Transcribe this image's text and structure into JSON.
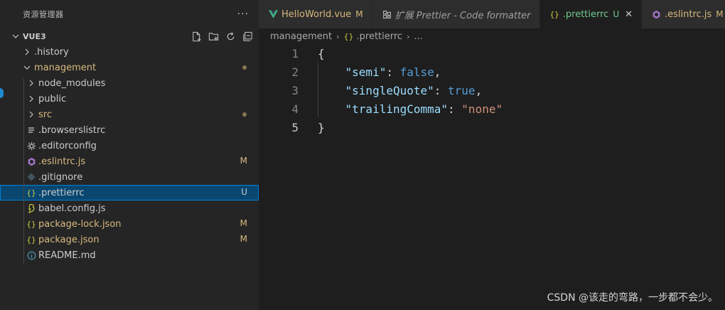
{
  "explorer": {
    "title": "资源管理器",
    "more": "···",
    "section": "VUE3",
    "actions": [
      "new-file-icon",
      "new-folder-icon",
      "refresh-icon",
      "collapse-all-icon"
    ],
    "items": [
      {
        "label": ".history",
        "type": "folder",
        "expanded": false,
        "indent": 1,
        "color": "#cccccc",
        "status": "",
        "dot": false
      },
      {
        "label": "management",
        "type": "folder",
        "expanded": true,
        "indent": 1,
        "color": "#d7ba7d",
        "status": "",
        "dot": true
      },
      {
        "label": "node_modules",
        "type": "folder",
        "expanded": false,
        "indent": 2,
        "color": "#cccccc",
        "status": "",
        "dot": false
      },
      {
        "label": "public",
        "type": "folder",
        "expanded": false,
        "indent": 2,
        "color": "#cccccc",
        "status": "",
        "dot": false
      },
      {
        "label": "src",
        "type": "folder",
        "expanded": false,
        "indent": 2,
        "color": "#d7ba7d",
        "status": "",
        "dot": true
      },
      {
        "label": ".browserslistrc",
        "type": "file",
        "icon": "lines",
        "iconColor": "#cccccc",
        "indent": 2,
        "color": "#cccccc",
        "status": "",
        "dot": false
      },
      {
        "label": ".editorconfig",
        "type": "file",
        "icon": "gear",
        "iconColor": "#a0a0a0",
        "indent": 2,
        "color": "#cccccc",
        "status": "",
        "dot": false
      },
      {
        "label": ".eslintrc.js",
        "type": "file",
        "icon": "eslint",
        "iconColor": "#a074c4",
        "indent": 2,
        "color": "#d7ba7d",
        "status": "M",
        "dot": false
      },
      {
        "label": ".gitignore",
        "type": "file",
        "icon": "git",
        "iconColor": "#41535b",
        "indent": 2,
        "color": "#cccccc",
        "status": "",
        "dot": false
      },
      {
        "label": ".prettierrc",
        "type": "file",
        "icon": "braces",
        "iconColor": "#cbcb41",
        "indent": 2,
        "color": "#cccccc",
        "status": "U",
        "dot": false,
        "selected": true
      },
      {
        "label": "babel.config.js",
        "type": "file",
        "icon": "babel",
        "iconColor": "#cbcb41",
        "indent": 2,
        "color": "#cccccc",
        "status": "",
        "dot": false
      },
      {
        "label": "package-lock.json",
        "type": "file",
        "icon": "braces",
        "iconColor": "#cbcb41",
        "indent": 2,
        "color": "#d7ba7d",
        "status": "M",
        "dot": false
      },
      {
        "label": "package.json",
        "type": "file",
        "icon": "braces",
        "iconColor": "#cbcb41",
        "indent": 2,
        "color": "#d7ba7d",
        "status": "M",
        "dot": false
      },
      {
        "label": "README.md",
        "type": "file",
        "icon": "info",
        "iconColor": "#519aba",
        "indent": 2,
        "color": "#cccccc",
        "status": "",
        "dot": false
      }
    ]
  },
  "tabs": [
    {
      "label": "HelloWorld.vue",
      "icon": "vue-icon",
      "iconColor": "#41b883",
      "color": "#d7ba7d",
      "status": "M",
      "italic": false,
      "active": false
    },
    {
      "label": "扩展 Prettier - Code formatter",
      "icon": "extension-icon",
      "iconColor": "#cccccc",
      "color": "#a0a0a0",
      "status": "",
      "italic": true,
      "active": false
    },
    {
      "label": ".prettierrc",
      "icon": "braces-icon",
      "iconColor": "#cbcb41",
      "color": "#73c991",
      "status": "U",
      "italic": false,
      "active": true,
      "close": "✕"
    },
    {
      "label": ".eslintrc.js",
      "icon": "eslint-icon",
      "iconColor": "#a074c4",
      "color": "#d7ba7d",
      "status": "M",
      "italic": false,
      "active": false
    }
  ],
  "breadcrumb": {
    "folder": "management",
    "file": ".prettierrc",
    "tail": "..."
  },
  "editor": {
    "lines": [
      {
        "n": "1",
        "tokens": [
          {
            "t": "{",
            "c": "punc"
          }
        ]
      },
      {
        "n": "2",
        "tokens": [
          {
            "t": "    ",
            "c": "punc"
          },
          {
            "t": "\"semi\"",
            "c": "key"
          },
          {
            "t": ": ",
            "c": "punc"
          },
          {
            "t": "false",
            "c": "bool"
          },
          {
            "t": ",",
            "c": "punc"
          }
        ]
      },
      {
        "n": "3",
        "tokens": [
          {
            "t": "    ",
            "c": "punc"
          },
          {
            "t": "\"singleQuote\"",
            "c": "key"
          },
          {
            "t": ": ",
            "c": "punc"
          },
          {
            "t": "true",
            "c": "bool"
          },
          {
            "t": ",",
            "c": "punc"
          }
        ]
      },
      {
        "n": "4",
        "tokens": [
          {
            "t": "    ",
            "c": "punc"
          },
          {
            "t": "\"trailingComma\"",
            "c": "key"
          },
          {
            "t": ": ",
            "c": "punc"
          },
          {
            "t": "\"none\"",
            "c": "str"
          }
        ]
      },
      {
        "n": "5",
        "tokens": [
          {
            "t": "}",
            "c": "punc"
          }
        ]
      }
    ],
    "currentLine": "5"
  },
  "watermark": "CSDN @该走的弯路，一步都不会少。"
}
